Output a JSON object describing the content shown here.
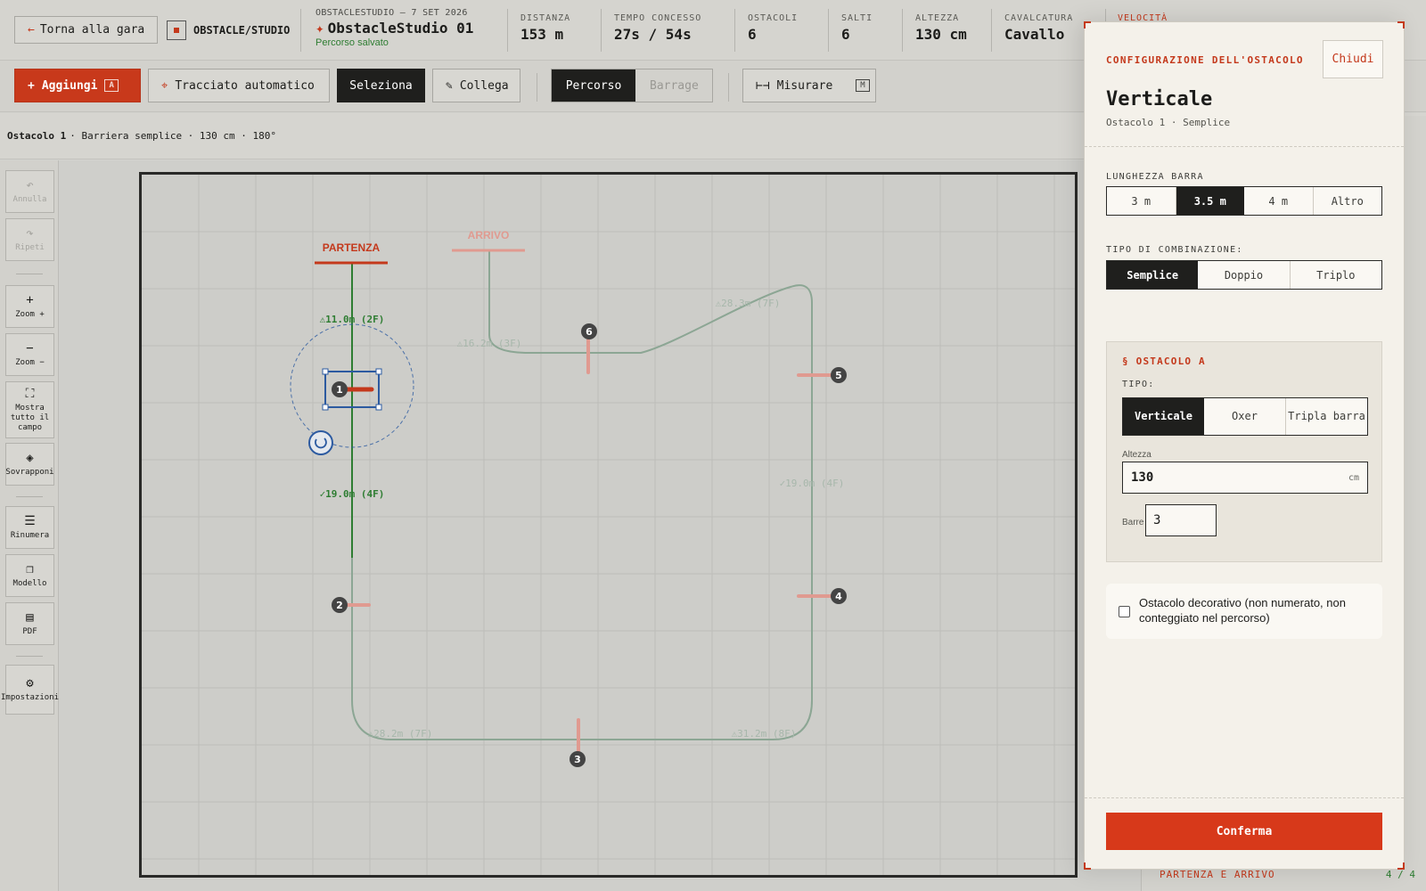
{
  "header": {
    "back_label": "Torna alla gara",
    "studio_label": "OBSTACLE/STUDIO",
    "crumb": "OBSTACLESTUDIO — 7 SET 2026",
    "course_name": "ObstacleStudio 01",
    "saved_status": "Percorso salvato",
    "stats": [
      {
        "label": "DISTANZA",
        "value": "153 m"
      },
      {
        "label": "TEMPO CONCESSO",
        "value": "27s / 54s"
      },
      {
        "label": "OSTACOLI",
        "value": "6"
      },
      {
        "label": "SALTI",
        "value": "6"
      },
      {
        "label": "ALTEZZA",
        "value": "130 cm"
      },
      {
        "label": "CAVALCATURA",
        "value": "Cavallo"
      },
      {
        "label": "VELOCITÀ",
        "value": ""
      }
    ]
  },
  "toolbar": {
    "add_label": "Aggiungi",
    "add_key": "A",
    "auto_label": "Tracciato automatico",
    "select_label": "Seleziona",
    "link_label": "Collega",
    "mode_course": "Percorso",
    "mode_barrage": "Barrage",
    "measure_label": "Misurare",
    "measure_key": "M"
  },
  "infobar": {
    "obstacle": "Ostacolo 1",
    "details": "· Barriera semplice · 130 cm · 180°"
  },
  "rail": {
    "undo": "Annulla",
    "redo": "Ripeti",
    "zoom_in": "Zoom +",
    "zoom_out": "Zoom −",
    "fit": "Mostra tutto il campo",
    "overlay": "Sovrapponi",
    "renumber": "Rinumera",
    "template": "Modello",
    "pdf": "PDF",
    "settings": "Impostazioni"
  },
  "canvas": {
    "start_label": "PARTENZA",
    "finish_label": "ARRIVO",
    "distances": [
      "⚠11.0m (2F)",
      "✓19.0m (4F)",
      "⚠16.2m (3F)",
      "⚠28.3m (7F)",
      "✓19.0m (4F)",
      "⚠28.2m (7F)",
      "⚠31.2m (8F)"
    ],
    "obstacle_numbers": [
      "1",
      "2",
      "3",
      "4",
      "5",
      "6"
    ]
  },
  "behind_panel": {
    "footer": "PARTENZA E ARRIVO",
    "footer_count": "4 / 4"
  },
  "modal": {
    "kicker": "CONFIGURAZIONE DELL'OSTACOLO",
    "close": "Chiudi",
    "title": "Verticale",
    "subtitle": "Ostacolo 1 · Semplice",
    "bar_length_label": "LUNGHEZZA BARRA",
    "bar_lengths": [
      "3 m",
      "3.5 m",
      "4 m",
      "Altro"
    ],
    "bar_length_selected": "3.5 m",
    "combination_label": "TIPO DI COMBINAZIONE:",
    "combinations": [
      "Semplice",
      "Doppio",
      "Triplo"
    ],
    "combination_selected": "Semplice",
    "section_title": "§ OSTACOLO A",
    "type_label": "TIPO:",
    "types": [
      "Verticale",
      "Oxer",
      "Tripla barra"
    ],
    "type_selected": "Verticale",
    "height_label": "Altezza",
    "height_value": "130",
    "height_unit": "cm",
    "bars_label": "Barre",
    "bars_value": "3",
    "decorative_label": "Ostacolo decorativo (non numerato, non conteggiato nel percorso)",
    "confirm": "Conferma"
  },
  "colors": {
    "accent": "#c4391c",
    "path": "#7e9c88",
    "path_active": "#2e7d32",
    "selection": "#2c5aa0"
  }
}
